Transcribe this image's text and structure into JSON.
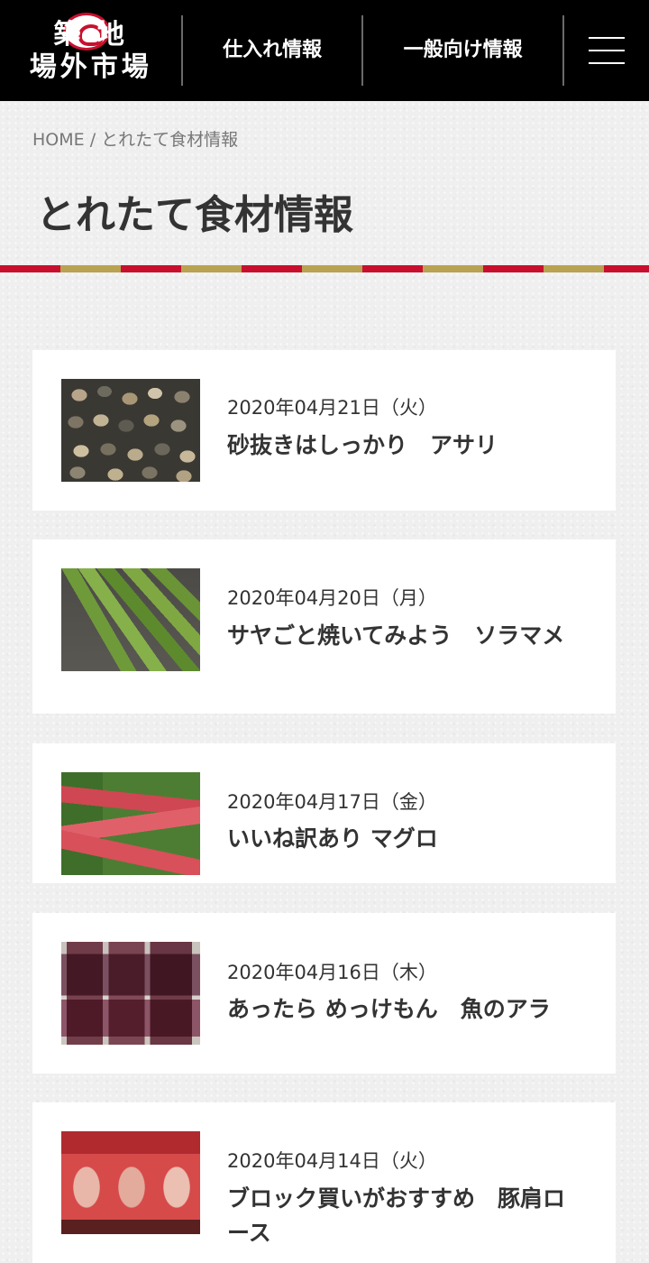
{
  "header": {
    "logo_line1": "築 地",
    "logo_line2": "場外市場",
    "nav": [
      {
        "label": "仕入れ情報"
      },
      {
        "label": "一般向け情報"
      }
    ]
  },
  "breadcrumb": {
    "home": "HOME",
    "separator": "/",
    "current": "とれたて食材情報"
  },
  "page_title": "とれたて食材情報",
  "colors": {
    "header_bg": "#000000",
    "stripe_red": "#c8102e",
    "stripe_gold": "#b9a251"
  },
  "articles": [
    {
      "date": "2020年04月21日（火）",
      "title": "砂抜きはしっかり　アサリ"
    },
    {
      "date": "2020年04月20日（月）",
      "title": "サヤごと焼いてみよう　ソラマメ"
    },
    {
      "date": "2020年04月17日（金）",
      "title": "いいね訳あり マグロ"
    },
    {
      "date": "2020年04月16日（木）",
      "title": "あったら めっけもん　魚のアラ"
    },
    {
      "date": "2020年04月14日（火）",
      "title": "ブロック買いがおすすめ　豚肩ロース"
    }
  ]
}
